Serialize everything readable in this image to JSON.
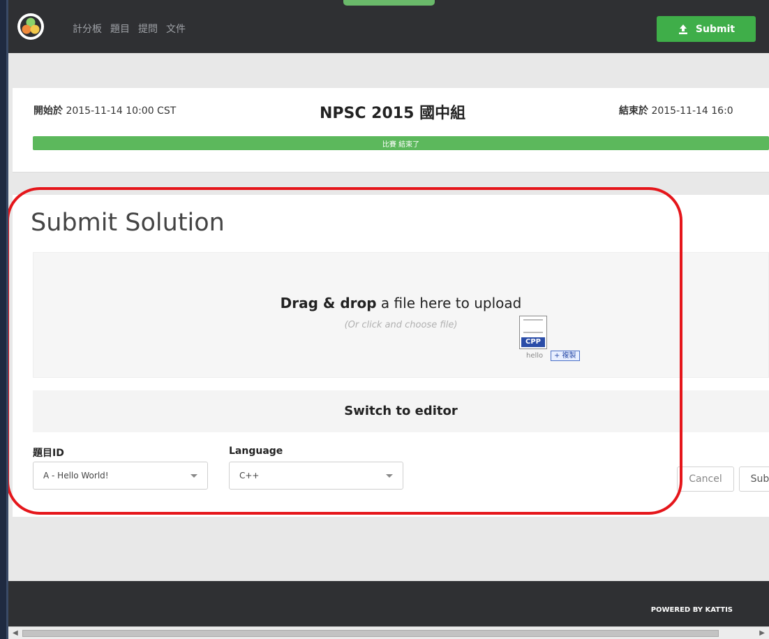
{
  "nav": {
    "links": [
      "計分板",
      "題目",
      "提問",
      "文件"
    ],
    "submit_label": "Submit"
  },
  "contest": {
    "start_label": "開始於",
    "start_time": "2015-11-14 10:00 CST",
    "title": "NPSC 2015 國中組",
    "end_label": "結束於",
    "end_time": "2015-11-14 16:0",
    "progress_text": "比賽 結束了",
    "progress_fraction": 1.0
  },
  "submit": {
    "heading": "Submit Solution",
    "drop_bold": "Drag & drop",
    "drop_rest": "a file here to upload",
    "drop_sub": "(Or click and choose file)",
    "drag_file_ext": "CPP",
    "drag_file_name": "hello",
    "drag_copy": "+ 複製",
    "switch_editor": "Switch to editor",
    "problem_label": "題目ID",
    "problem_value": "A - Hello World!",
    "language_label": "Language",
    "language_value": "C++",
    "cancel_label": "Cancel",
    "submit_label": "Sub"
  },
  "footer": {
    "powered": "POWERED BY KATTIS"
  },
  "colors": {
    "accent_green": "#3fae49",
    "highlight_red": "#e5161b",
    "nav_bg": "#2f3033"
  }
}
